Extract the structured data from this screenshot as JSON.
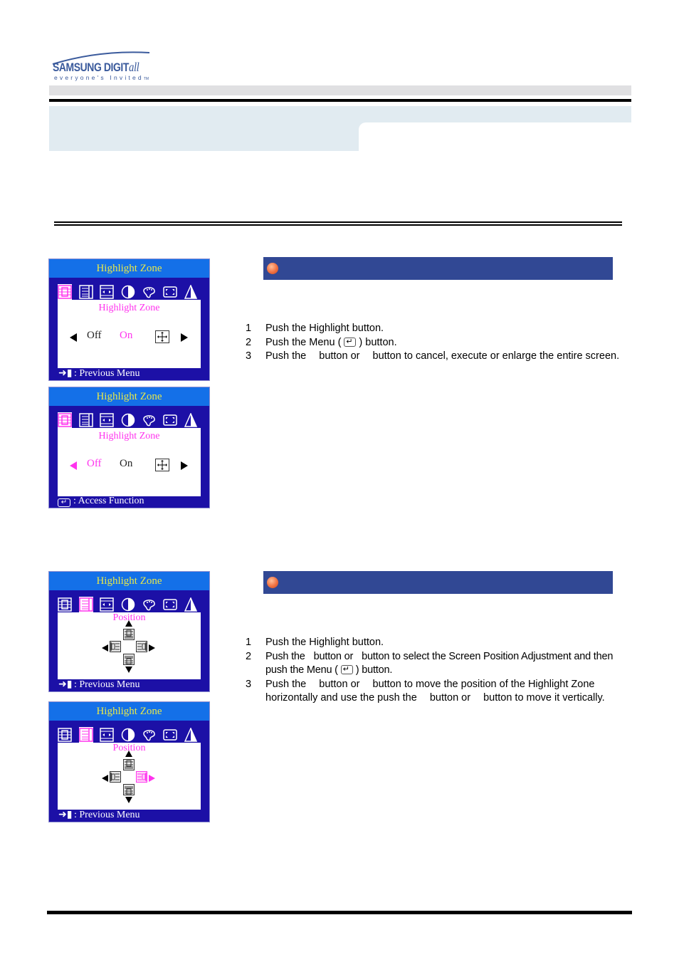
{
  "logo": {
    "brand": "SAMSUNG DIGIT",
    "brand_script": "all",
    "tagline": "everyone's Invited",
    "trademark": "TM"
  },
  "colors": {
    "osd_background": "#1c10a6",
    "osd_title_bar": "#1470e8",
    "osd_title_text": "#e8e84a",
    "osd_highlight": "#ff33ee",
    "section_bar": "#314894",
    "header_band": "#e1ebf1"
  },
  "sections": [
    {
      "header_label": "",
      "steps": [
        {
          "num": "1",
          "text": "Push the Highlight  button."
        },
        {
          "num": "2",
          "text_before": "Push the Menu (",
          "text_after": ") button.",
          "key_icon": "enter-key-icon"
        },
        {
          "num": "3",
          "text_a": "Push the",
          "text_b": "button or",
          "text_c": "button to cancel, execute or enlarge the entire screen."
        }
      ],
      "screens": [
        {
          "title": "Highlight Zone",
          "subtitle": "Highlight Zone",
          "options": [
            "Off",
            "On"
          ],
          "selected": "On",
          "footer_icon": "exit-icon",
          "footer": ": Previous Menu",
          "active_tab": 0
        },
        {
          "title": "Highlight Zone",
          "subtitle": "Highlight Zone",
          "options": [
            "Off",
            "On"
          ],
          "selected": "Off",
          "footer_icon": "enter-key-icon",
          "footer": ": Access Function",
          "active_tab": 0
        }
      ]
    },
    {
      "header_label": "",
      "steps": [
        {
          "num": "1",
          "text": "Push the Highlight button."
        },
        {
          "num": "2",
          "text_a": "Push the",
          "text_b": "button or",
          "text_c": "button to select the Screen Position Adjustment and then push the Menu (",
          "text_after": ") button.",
          "key_icon": "enter-key-icon"
        },
        {
          "num": "3",
          "text_a": "Push the",
          "text_b": "button or",
          "text_c": "button to move the position of the Highlight Zone horizontally and use the push the",
          "text_d": "button or",
          "text_e": "button to move it vertically."
        }
      ],
      "screens": [
        {
          "title": "Highlight Zone",
          "subtitle": "Position",
          "footer_icon": "exit-icon",
          "footer": ": Previous Menu",
          "active_tab": 1,
          "active_direction": "none"
        },
        {
          "title": "Highlight Zone",
          "subtitle": "Position",
          "footer_icon": "exit-icon",
          "footer": ": Previous Menu",
          "active_tab": 1,
          "active_direction": "right"
        }
      ]
    }
  ],
  "osd_tabs": [
    {
      "icon": "highlight-zone-icon"
    },
    {
      "icon": "position-icon"
    },
    {
      "icon": "size-icon"
    },
    {
      "icon": "brightness-contrast-icon"
    },
    {
      "icon": "color-icon"
    },
    {
      "icon": "full-screen-icon"
    },
    {
      "icon": "sharpness-icon"
    }
  ]
}
